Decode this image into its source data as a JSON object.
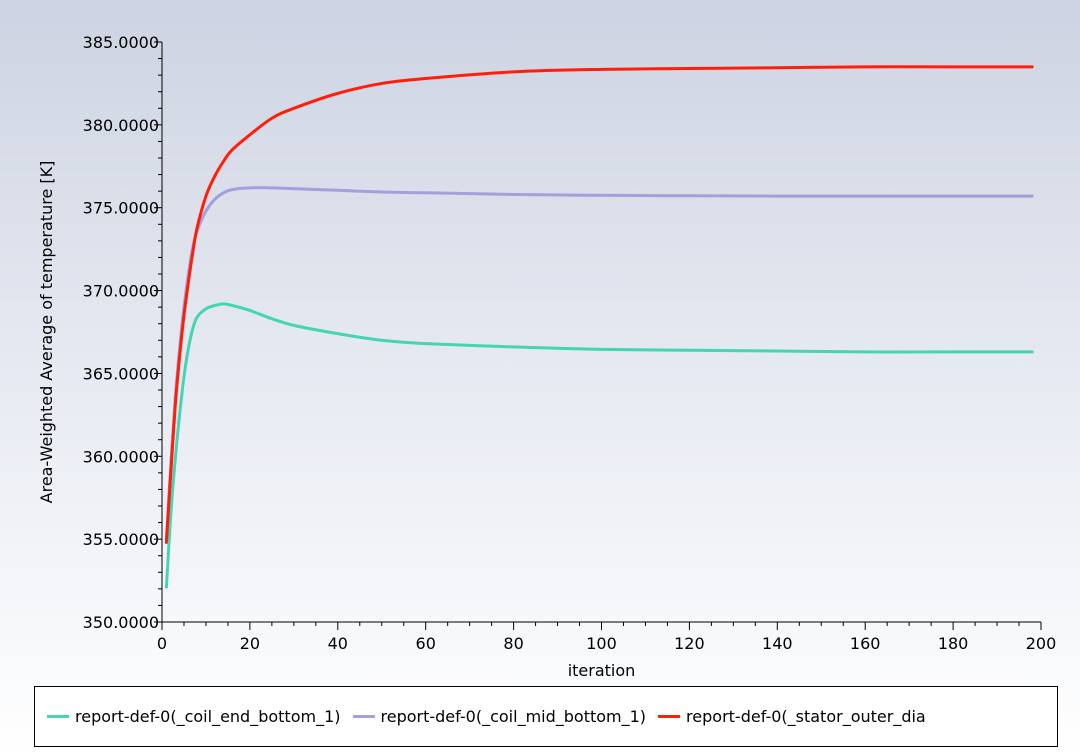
{
  "chart_data": {
    "type": "line",
    "title": "",
    "xlabel": "iteration",
    "ylabel": "Area-Weighted Average of temperature [K]",
    "xlim": [
      0,
      200
    ],
    "ylim": [
      350,
      385
    ],
    "x_ticks": [
      "0",
      "20",
      "40",
      "60",
      "80",
      "100",
      "120",
      "140",
      "160",
      "180",
      "200"
    ],
    "y_ticks": [
      "350.0000",
      "355.0000",
      "360.0000",
      "365.0000",
      "370.0000",
      "375.0000",
      "380.0000",
      "385.0000"
    ],
    "grid": false,
    "legend_position": "bottom",
    "series": [
      {
        "name": "report-def-0(_coil_end_bottom_1)",
        "color": "#45d4b4",
        "x": [
          1,
          2,
          3,
          4,
          5,
          6,
          7,
          8,
          10,
          12,
          14,
          16,
          20,
          25,
          30,
          40,
          50,
          60,
          80,
          100,
          120,
          140,
          160,
          180,
          198
        ],
        "y": [
          352.1,
          356.5,
          359.8,
          362.5,
          364.8,
          366.5,
          367.7,
          368.4,
          368.9,
          369.1,
          369.2,
          369.1,
          368.8,
          368.3,
          367.9,
          367.4,
          367.0,
          366.8,
          366.6,
          366.45,
          366.4,
          366.35,
          366.3,
          366.3,
          366.3
        ]
      },
      {
        "name": "report-def-0(_coil_mid_bottom_1)",
        "color": "#a49fdd",
        "x": [
          1,
          2,
          3,
          4,
          5,
          6,
          7,
          8,
          10,
          12,
          14,
          16,
          20,
          25,
          30,
          40,
          50,
          60,
          80,
          100,
          120,
          140,
          160,
          180,
          198
        ],
        "y": [
          355.0,
          359.5,
          363.5,
          366.5,
          369.0,
          371.0,
          372.6,
          373.6,
          374.8,
          375.5,
          375.9,
          376.1,
          376.2,
          376.2,
          376.15,
          376.05,
          375.95,
          375.9,
          375.8,
          375.75,
          375.72,
          375.7,
          375.7,
          375.7,
          375.7
        ]
      },
      {
        "name": "report-def-0(_stator_outer_dia",
        "color": "#ff1e0a",
        "x": [
          1,
          2,
          3,
          4,
          5,
          6,
          7,
          8,
          10,
          12,
          14,
          16,
          20,
          25,
          30,
          40,
          50,
          60,
          80,
          100,
          120,
          140,
          160,
          180,
          198
        ],
        "y": [
          354.8,
          359.0,
          363.0,
          366.0,
          368.5,
          370.5,
          372.3,
          373.8,
          375.7,
          376.9,
          377.8,
          378.5,
          379.4,
          380.4,
          381.0,
          381.9,
          382.5,
          382.8,
          383.2,
          383.35,
          383.4,
          383.45,
          383.5,
          383.5,
          383.5
        ]
      }
    ]
  }
}
